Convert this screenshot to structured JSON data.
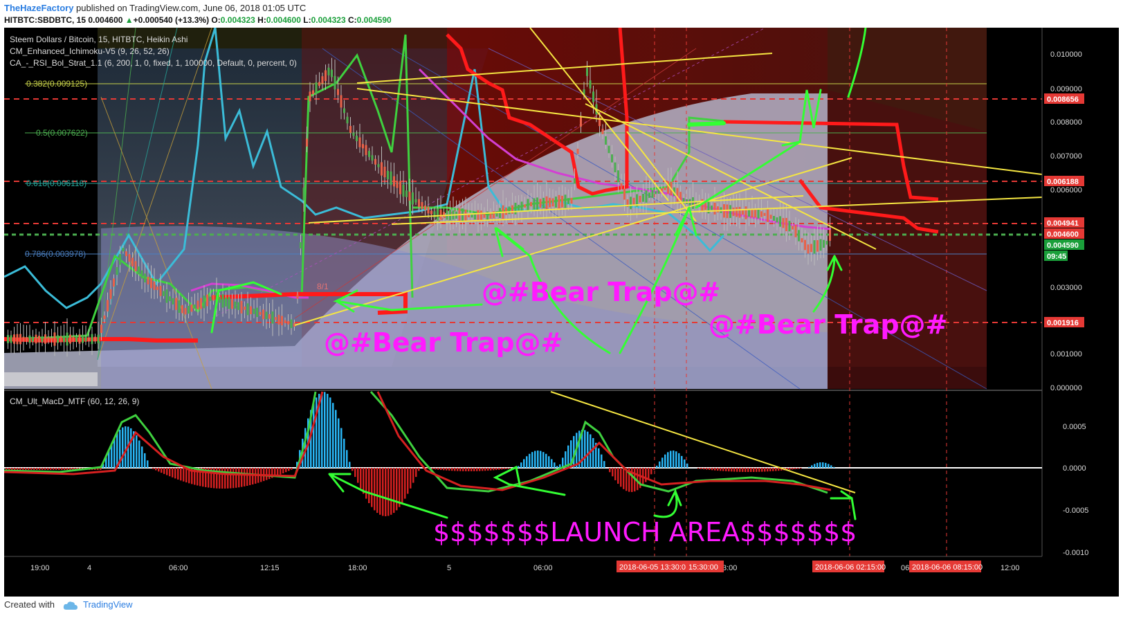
{
  "header": {
    "author": "TheHazeFactory",
    "published_text": "published on TradingView.com, June 06, 2018 01:05 UTC",
    "symbol": "HITBTC:SBDBTC, 15",
    "last": "0.004600",
    "change_arrow": "▲",
    "change": "+0.000540 (+13.3%)",
    "o_label": "O:",
    "o_value": "0.004323",
    "h_label": "H:",
    "h_value": "0.004600",
    "l_label": "L:",
    "l_value": "0.004323",
    "c_label": "C:",
    "c_value": "0.004590"
  },
  "legend": {
    "line1": "Steem Dollars / Bitcoin, 15, HITBTC, Heikin Ashi",
    "line2": "CM_Enhanced_Ichimoku-V5 (9, 26, 52, 26)",
    "line3": "CA_-_RSI_Bol_Strat_1.1 (6, 200, 1, 0, fixed, 1, 100000, Default, 0, percent, 0)",
    "macd": "CM_Ult_MacD_MTF (60, 12, 26, 9)"
  },
  "fib_labels": [
    {
      "text": "0.382(0.009125)",
      "color": "#c8d24a"
    },
    {
      "text": "0.5(0.007622)",
      "color": "#4caf50"
    },
    {
      "text": "0.618(0.006118)",
      "color": "#26a69a"
    },
    {
      "text": "0.786(0.003978)",
      "color": "#4a7fc1"
    }
  ],
  "annotations": {
    "bear_trap_1": "@#Bear Trap@#",
    "bear_trap_2": "@#Bear Trap@#",
    "bear_trap_3": "@#Bear Trap@#",
    "launch": "$$$$$$$LAUNCH AREA$$$$$$$",
    "small_label": "8/1"
  },
  "price_axis": {
    "ticks": [
      "0.010000",
      "0.009000",
      "0.008000",
      "0.007000",
      "0.006000",
      "0.003000",
      "0.001000",
      "0.000000"
    ],
    "tick_partial": "0",
    "badges": [
      {
        "text": "0.008656",
        "color": "#e53935"
      },
      {
        "text": "0.006188",
        "color": "#e53935"
      },
      {
        "text": "0.004941",
        "color": "#e53935"
      },
      {
        "text": "0.004600",
        "color": "#e53935"
      },
      {
        "text": "0.004590",
        "color": "#1a9f3a"
      },
      {
        "text": "09:45",
        "color": "#1a9f3a"
      },
      {
        "text": "0.001916",
        "color": "#e53935"
      }
    ]
  },
  "macd_axis": {
    "ticks": [
      "0.0005",
      "0.0000",
      "-0.0005",
      "-0.0010"
    ]
  },
  "time_axis": {
    "ticks": [
      "19:00",
      "4",
      "06:00",
      "12:15",
      "18:00",
      "5",
      "06:00",
      "3:00",
      "06",
      "12:00"
    ],
    "highlights": [
      "2018-06-05 13:30:00",
      "15:30:00",
      "2018-06-06 02:15:00",
      "2018-06-06 08:15:00"
    ]
  },
  "chart_data": {
    "type": "line",
    "title": "Steem Dollars / Bitcoin, 15, HITBTC, Heikin Ashi",
    "y_range": [
      0.0,
      0.0105
    ],
    "horizontal_levels": [
      0.008656,
      0.006188,
      0.004941,
      0.0046,
      0.001916
    ],
    "fib_levels": [
      0.009125,
      0.007622,
      0.006118,
      0.003978
    ],
    "series": [
      {
        "x": [
          "19:00",
          "4",
          "06:00",
          "12:15",
          "18:00",
          "5",
          "06:00",
          "15:30",
          "02:15"
        ],
        "values": [
          0.0015,
          0.0018,
          0.0026,
          0.0021,
          0.0083,
          0.0052,
          0.0049,
          0.0053,
          0.0043
        ]
      }
    ],
    "macd_range": [
      -0.0011,
      0.0009
    ]
  },
  "footer": {
    "created_with": "Created with",
    "brand": "TradingView"
  }
}
